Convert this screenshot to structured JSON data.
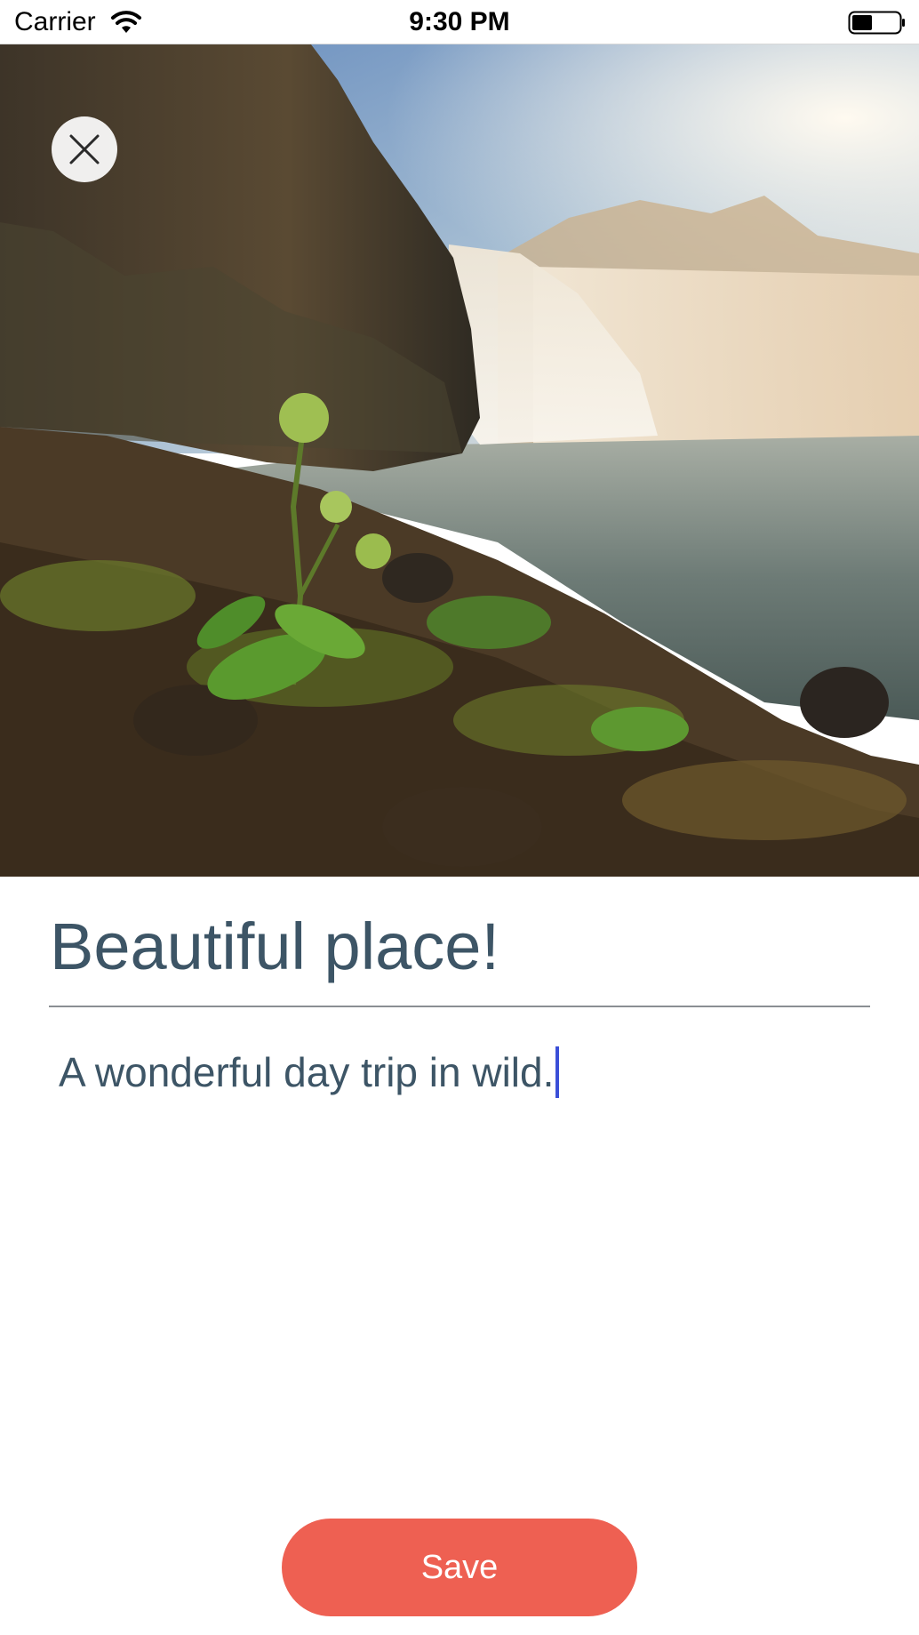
{
  "status_bar": {
    "carrier": "Carrier",
    "time": "9:30 PM",
    "wifi_icon": "wifi-icon",
    "battery_icon": "battery-icon",
    "battery_level": 0.45
  },
  "hero": {
    "image_subject": "waterfall landscape with mossy rocks and green plants",
    "close_icon": "close-icon"
  },
  "form": {
    "title_value": "Beautiful place!",
    "description_value": "A wonderful day trip in wild."
  },
  "actions": {
    "save_label": "Save"
  },
  "colors": {
    "text": "#3d5566",
    "accent_button": "#ee6052",
    "caret": "#3b4fd8",
    "divider": "#8a8f93"
  }
}
